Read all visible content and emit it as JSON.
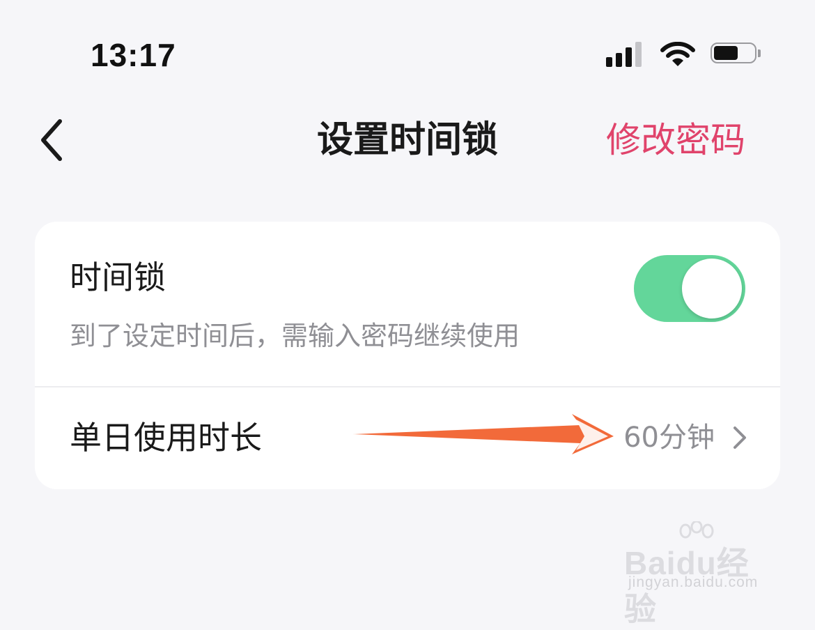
{
  "status_bar": {
    "time": "13:17",
    "signal_icon": "cellular-signal-icon",
    "wifi_icon": "wifi-icon",
    "battery_icon": "battery-icon"
  },
  "nav": {
    "back_icon": "chevron-left-icon",
    "title": "设置时间锁",
    "action_label": "修改密码",
    "action_color": "#e0436b"
  },
  "time_lock": {
    "title": "时间锁",
    "description": "到了设定时间后，需输入密码继续使用",
    "toggle_on": true,
    "toggle_color": "#63d69a"
  },
  "daily_usage": {
    "label": "单日使用时长",
    "value": "60分钟",
    "chevron_icon": "chevron-right-icon"
  },
  "annotation": {
    "arrow_icon": "pointer-arrow-icon",
    "arrow_color": "#f26a3a"
  },
  "watermark": {
    "brand": "Baidu经验",
    "url": "jingyan.baidu.com"
  }
}
